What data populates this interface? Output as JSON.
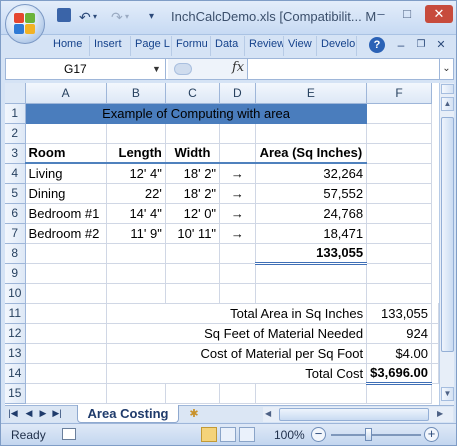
{
  "window": {
    "title": "InchCalcDemo.xls  [Compatibilit... M",
    "minimize_label": "–",
    "maximize_label": "□",
    "close_label": "✕"
  },
  "quick_access": {
    "undo_icon": "↶",
    "redo_icon": "↷",
    "customize_icon": "▾"
  },
  "ribbon": {
    "tabs": [
      "Home",
      "Insert",
      "Page L",
      "Formu",
      "Data",
      "Review",
      "View",
      "Develo"
    ],
    "help_label": "?",
    "mdi_minimize": "–",
    "mdi_restore": "❐",
    "mdi_close": "✕"
  },
  "formula_bar": {
    "name_box": "G17",
    "fx_label": "fx",
    "formula": "",
    "expand_label": "⌄"
  },
  "grid": {
    "column_headers": [
      "A",
      "B",
      "C",
      "D",
      "E",
      "F"
    ],
    "row_headers": [
      "1",
      "2",
      "3",
      "4",
      "5",
      "6",
      "7",
      "8",
      "9",
      "10",
      "11",
      "12",
      "13",
      "14",
      "15"
    ],
    "banner": "Example of Computing with area",
    "headers": {
      "room": "Room",
      "length": "Length",
      "width": "Width",
      "area": "Area (Sq Inches)"
    },
    "rows": [
      {
        "room": "Living",
        "length": "12' 4\"",
        "width": "18' 2\"",
        "arrow": "→",
        "area": "32,264"
      },
      {
        "room": "Dining",
        "length": "22'",
        "width": "18' 2\"",
        "arrow": "→",
        "area": "57,552"
      },
      {
        "room": "Bedroom #1",
        "length": "14' 4\"",
        "width": "12' 0\"",
        "arrow": "→",
        "area": "24,768"
      },
      {
        "room": "Bedroom #2",
        "length": "11' 9\"",
        "width": "10' 11\"",
        "arrow": "→",
        "area": "18,471"
      }
    ],
    "sum_area": "133,055",
    "summary": [
      {
        "label": "Total Area in Sq Inches",
        "value": "133,055"
      },
      {
        "label": "Sq Feet of Material Needed",
        "value": "924"
      },
      {
        "label": "Cost of Material per Sq Foot",
        "value": "$4.00"
      },
      {
        "label": "Total Cost",
        "value": "$3,696.00"
      }
    ]
  },
  "sheet_tabs": {
    "nav_icons": [
      "|◀",
      "◀",
      "▶",
      "▶|"
    ],
    "active": "Area Costing",
    "new_sheet_icon": "✱"
  },
  "status": {
    "text": "Ready",
    "zoom": "100%",
    "zoom_out": "−",
    "zoom_in": "+",
    "zoom_level_percent": 100
  },
  "colors": {
    "banner": "#4a7dbd",
    "header_text": "#1f4e9c",
    "accent": "#4f81bd"
  }
}
